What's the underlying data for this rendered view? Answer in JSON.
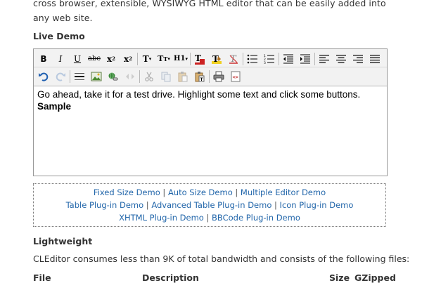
{
  "intro_text": "cross browser, extensible, WYSIWYG HTML editor that can be easily added into any web site.",
  "live_demo_heading": "Live Demo",
  "toolbar": {
    "bold": "B",
    "italic": "I",
    "underline": "U",
    "strikethrough": "abc",
    "subscript": "x",
    "subscript_small": "2",
    "superscript": "x",
    "superscript_small": "2",
    "font": "T",
    "size": "T",
    "size_small": "T",
    "style": "H1"
  },
  "editor_content": {
    "line1": "Go ahead, take it for a test drive. Highlight some text and click some buttons.",
    "line2": "Sample"
  },
  "demo_links": {
    "fixed_size": "Fixed Size Demo",
    "auto_size": "Auto Size Demo",
    "multiple_editor": "Multiple Editor Demo",
    "table_plugin": "Table Plug-in Demo",
    "advanced_table_plugin": "Advanced Table Plug-in Demo",
    "icon_plugin": "Icon Plug-in Demo",
    "xhtml_plugin": "XHTML Plug-in Demo",
    "bbcode_plugin": "BBCode Plug-in Demo",
    "separator": "|"
  },
  "lightweight_heading": "Lightweight",
  "lightweight_text": "CLEditor consumes less than 9K of total bandwidth and consists of the following files:",
  "table_headers": {
    "file": "File",
    "description": "Description",
    "size": "Size",
    "gzipped": "GZipped"
  },
  "colors": {
    "link": "#2266aa",
    "text": "#333333",
    "toolbar_bg": "#f2f2f2"
  }
}
